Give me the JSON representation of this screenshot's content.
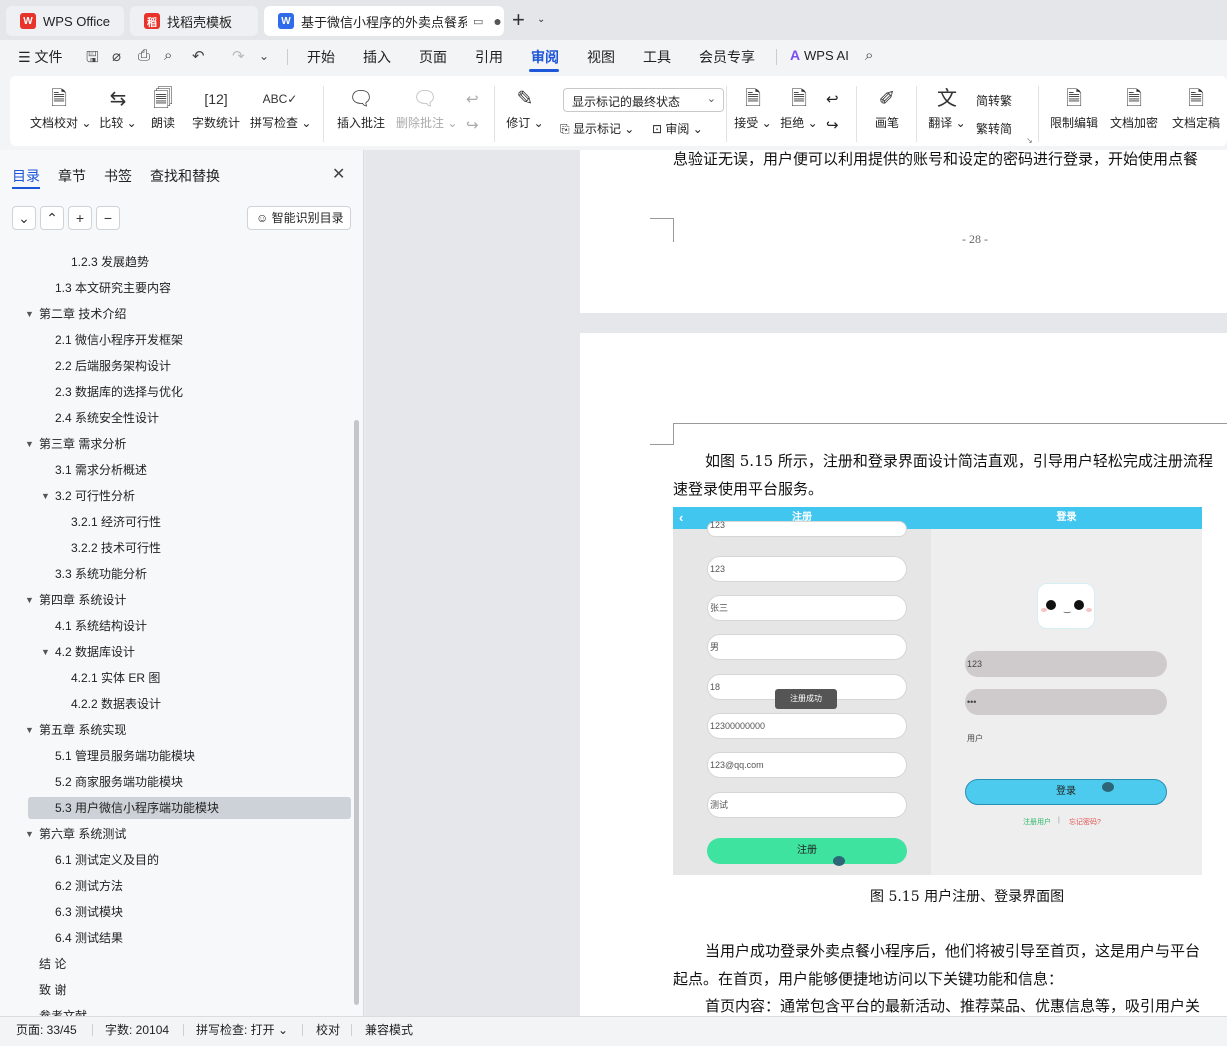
{
  "tabs": [
    {
      "title": "WPS Office",
      "icon": "wps-logo"
    },
    {
      "title": "找稻壳模板",
      "icon": "docer-icon"
    },
    {
      "title": "基于微信小程序的外卖点餐系统",
      "icon": "word-doc-icon"
    }
  ],
  "menu": {
    "file": "文件",
    "items": [
      "开始",
      "插入",
      "页面",
      "引用",
      "审阅",
      "视图",
      "工具",
      "会员专享"
    ],
    "active": "审阅",
    "ai": "WPS AI"
  },
  "ribbon": {
    "doc_check": "文档校对",
    "compare": "比较",
    "read_aloud": "朗读",
    "word_count": "字数统计",
    "spell_check": "拼写检查",
    "insert_comment": "插入批注",
    "delete_comment": "删除批注",
    "revise": "修订",
    "markup_mode": "显示标记的最终状态",
    "show_markup": "显示标记",
    "review": "审阅",
    "accept": "接受",
    "reject": "拒绝",
    "pen": "画笔",
    "translate": "翻译",
    "to_traditional": "繁转简",
    "to_traditional_a": "简",
    "to_traditional_b": "转繁",
    "to_simplified_a": "繁",
    "to_simplified_b": "转简",
    "restrict_edit": "限制编辑",
    "encrypt": "文档加密",
    "finalize": "文档定稿"
  },
  "nav_pane": {
    "tabs": [
      "目录",
      "章节",
      "书签",
      "查找和替换"
    ],
    "smart_toc": "智能识别目录",
    "toc": [
      {
        "label": "1.2.3  发展趋势",
        "level": 3
      },
      {
        "label": "1.3  本文研究主要内容",
        "level": 2
      },
      {
        "label": "第二章  技术介绍",
        "level": 1,
        "expanded": true
      },
      {
        "label": "2.1  微信小程序开发框架",
        "level": 2
      },
      {
        "label": "2.2  后端服务架构设计",
        "level": 2
      },
      {
        "label": "2.3  数据库的选择与优化",
        "level": 2
      },
      {
        "label": "2.4  系统安全性设计",
        "level": 2
      },
      {
        "label": "第三章  需求分析",
        "level": 1,
        "expanded": true
      },
      {
        "label": "3.1  需求分析概述",
        "level": 2
      },
      {
        "label": "3.2  可行性分析",
        "level": 2,
        "expanded": true
      },
      {
        "label": "3.2.1  经济可行性",
        "level": 3
      },
      {
        "label": "3.2.2  技术可行性",
        "level": 3
      },
      {
        "label": "3.3  系统功能分析",
        "level": 2
      },
      {
        "label": "第四章  系统设计",
        "level": 1,
        "expanded": true
      },
      {
        "label": "4.1 系统结构设计",
        "level": 2
      },
      {
        "label": "4.2  数据库设计",
        "level": 2,
        "expanded": true
      },
      {
        "label": "4.2.1  实体 ER 图",
        "level": 3
      },
      {
        "label": "4.2.2  数据表设计",
        "level": 3
      },
      {
        "label": "第五章  系统实现",
        "level": 1,
        "expanded": true
      },
      {
        "label": "5.1  管理员服务端功能模块",
        "level": 2
      },
      {
        "label": "5.2  商家服务端功能模块",
        "level": 2
      },
      {
        "label": "5.3 用户微信小程序端功能模块",
        "level": 2,
        "selected": true
      },
      {
        "label": "第六章  系统测试",
        "level": 1,
        "expanded": true
      },
      {
        "label": "6.1  测试定义及目的",
        "level": 2
      },
      {
        "label": "6.2  测试方法",
        "level": 2
      },
      {
        "label": "6.3  测试模块",
        "level": 2
      },
      {
        "label": "6.4  测试结果",
        "level": 2
      },
      {
        "label": "结    论",
        "level": 1
      },
      {
        "label": "致    谢",
        "level": 1
      },
      {
        "label": "参考文献",
        "level": 1
      }
    ]
  },
  "document": {
    "top_line": "息验证无误，用户便可以利用提供的账号和设定的密码进行登录，开始使用点餐",
    "page_number": "- 28 -",
    "para1_line1": "如图 5.15 所示，注册和登录界面设计简洁直观，引导用户轻松完成注册流程",
    "para1_line2": "速登录使用平台服务。",
    "caption": "图 5.15 用户注册、登录界面图",
    "para2_line1": "当用户成功登录外卖点餐小程序后，他们将被引导至首页，这是用户与平台",
    "para2_line2": "起点。在首页，用户能够便捷地访问以下关键功能和信息：",
    "para3_line1": "首页内容：通常包含平台的最新活动、推荐菜品、优惠信息等，吸引用户关"
  },
  "figure": {
    "register_title": "注册",
    "login_title": "登录",
    "register_fields": [
      "123",
      "123",
      "张三",
      "男",
      "18",
      "12300000000",
      "123@qq.com",
      "测试"
    ],
    "toast": "注册成功",
    "register_button": "注册",
    "login_fields": [
      "123",
      "•••"
    ],
    "user_role": "用户",
    "login_button": "登录",
    "register_link": "注册用户",
    "link_sep": "|",
    "forgot_link": "忘记密码?"
  },
  "status": {
    "page": "页面: 33/45",
    "words": "字数: 20104",
    "spell": "拼写检查: 打开",
    "proof": "校对",
    "compat": "兼容模式"
  },
  "colors": {
    "accent": "#1d56d8",
    "figure_bar": "#41c6f0",
    "register_button": "#3de39f",
    "login_button": "#4ccbee"
  }
}
